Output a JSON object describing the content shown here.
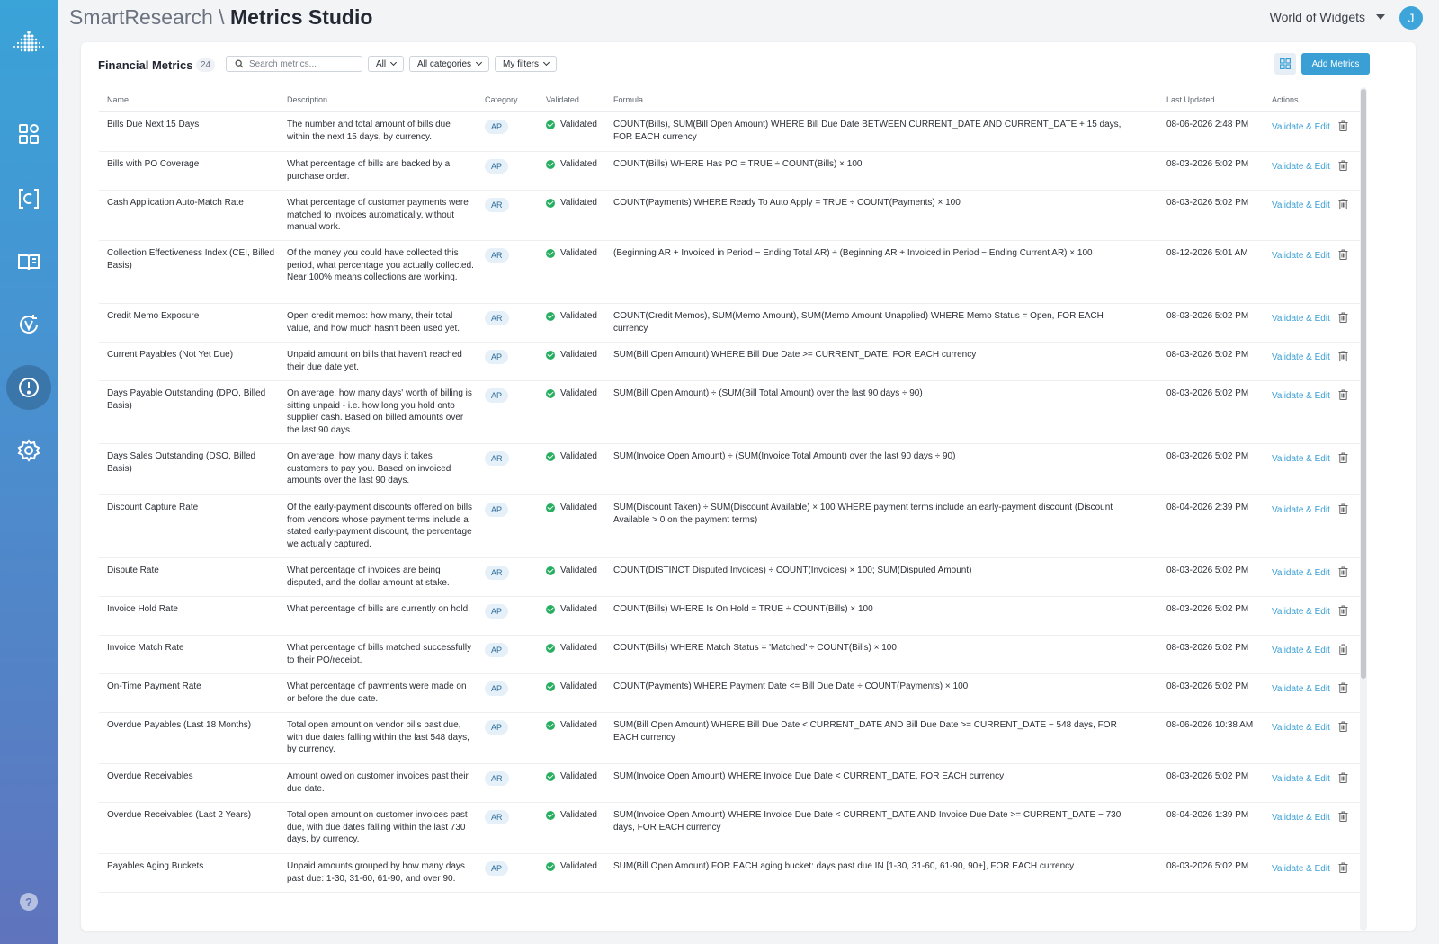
{
  "header": {
    "brand": "SmartResearch",
    "separator": " \\ ",
    "app_name": "Metrics Studio",
    "workspace": "World of Widgets",
    "avatar_initial": "J"
  },
  "toolbar": {
    "title": "Financial Metrics",
    "count": "24",
    "search_placeholder": "Search metrics...",
    "filter_status": "All",
    "filter_category": "All categories",
    "filter_mine": "My filters",
    "add_label": "Add Metrics"
  },
  "columns": {
    "name": "Name",
    "description": "Description",
    "category": "Category",
    "validated": "Validated",
    "formula": "Formula",
    "updated": "Last Updated",
    "actions": "Actions"
  },
  "action_label": "Validate & Edit",
  "help": "?",
  "colors": {
    "accent": "#3a9fd5",
    "validated": "#27ae60",
    "sidebar_top": "#3aa3d8",
    "sidebar_bottom": "#5f74bd"
  },
  "rows": [
    {
      "name": "Bills Due Next 15 Days",
      "description": "The number and total amount of bills due within the next 15 days, by currency.",
      "category": "AP",
      "validated": "Validated",
      "formula": "COUNT(Bills), SUM(Bill Open Amount) WHERE Bill Due Date BETWEEN CURRENT_DATE AND CURRENT_DATE + 15 days, FOR EACH currency",
      "updated": "08-06-2026 2:48 PM"
    },
    {
      "name": "Bills with PO Coverage",
      "description": "What percentage of bills are backed by a purchase order.",
      "category": "AP",
      "validated": "Validated",
      "formula": "COUNT(Bills) WHERE Has PO = TRUE ÷ COUNT(Bills) × 100",
      "updated": "08-03-2026 5:02 PM"
    },
    {
      "name": "Cash Application Auto-Match Rate",
      "description": "What percentage of customer payments were matched to invoices automatically, without manual work.",
      "category": "AR",
      "validated": "Validated",
      "formula": "COUNT(Payments) WHERE Ready To Auto Apply = TRUE ÷ COUNT(Payments) × 100",
      "updated": "08-03-2026 5:02 PM"
    },
    {
      "name": "Collection Effectiveness Index (CEI, Billed Basis)",
      "description": "Of the money you could have collected this period, what percentage you actually collected. Near 100% means collections are working.",
      "category": "AR",
      "validated": "Validated",
      "formula": "(Beginning AR + Invoiced in Period − Ending Total AR) ÷ (Beginning AR + Invoiced in Period − Ending Current AR) × 100",
      "updated": "08-12-2026 5:01 AM"
    },
    {
      "name": "Credit Memo Exposure",
      "description": "Open credit memos: how many, their total value, and how much hasn't been used yet.",
      "category": "AR",
      "validated": "Validated",
      "formula": "COUNT(Credit Memos), SUM(Memo Amount), SUM(Memo Amount Unapplied) WHERE Memo Status = Open, FOR EACH currency",
      "updated": "08-03-2026 5:02 PM"
    },
    {
      "name": "Current Payables (Not Yet Due)",
      "description": "Unpaid amount on bills that haven't reached their due date yet.",
      "category": "AP",
      "validated": "Validated",
      "formula": "SUM(Bill Open Amount) WHERE Bill Due Date >= CURRENT_DATE, FOR EACH currency",
      "updated": "08-03-2026 5:02 PM"
    },
    {
      "name": "Days Payable Outstanding (DPO, Billed Basis)",
      "description": "On average, how many days' worth of billing is sitting unpaid - i.e. how long you hold onto supplier cash. Based on billed amounts over the last 90 days.",
      "category": "AP",
      "validated": "Validated",
      "formula": "SUM(Bill Open Amount) ÷ (SUM(Bill Total Amount) over the last 90 days ÷ 90)",
      "updated": "08-03-2026 5:02 PM"
    },
    {
      "name": "Days Sales Outstanding (DSO, Billed Basis)",
      "description": "On average, how many days it takes customers to pay you. Based on invoiced amounts over the last 90 days.",
      "category": "AR",
      "validated": "Validated",
      "formula": "SUM(Invoice Open Amount) ÷ (SUM(Invoice Total Amount) over the last 90 days ÷ 90)",
      "updated": "08-03-2026 5:02 PM"
    },
    {
      "name": "Discount Capture Rate",
      "description": "Of the early-payment discounts offered on bills from vendors whose payment terms include a stated early-payment discount, the percentage we actually captured.",
      "category": "AP",
      "validated": "Validated",
      "formula": "SUM(Discount Taken) ÷ SUM(Discount Available) × 100 WHERE payment terms include an early-payment discount (Discount Available > 0 on the payment terms)",
      "updated": "08-04-2026 2:39 PM"
    },
    {
      "name": "Dispute Rate",
      "description": "What percentage of invoices are being disputed, and the dollar amount at stake.",
      "category": "AR",
      "validated": "Validated",
      "formula": "COUNT(DISTINCT Disputed Invoices) ÷ COUNT(Invoices) × 100; SUM(Disputed Amount)",
      "updated": "08-03-2026 5:02 PM"
    },
    {
      "name": "Invoice Hold Rate",
      "description": "What percentage of bills are currently on hold.",
      "category": "AP",
      "validated": "Validated",
      "formula": "COUNT(Bills) WHERE Is On Hold = TRUE ÷ COUNT(Bills) × 100",
      "updated": "08-03-2026 5:02 PM"
    },
    {
      "name": "Invoice Match Rate",
      "description": "What percentage of bills matched successfully to their PO/receipt.",
      "category": "AP",
      "validated": "Validated",
      "formula": "COUNT(Bills) WHERE Match Status = 'Matched' ÷ COUNT(Bills) × 100",
      "updated": "08-03-2026 5:02 PM"
    },
    {
      "name": "On-Time Payment Rate",
      "description": "What percentage of payments were made on or before the due date.",
      "category": "AP",
      "validated": "Validated",
      "formula": "COUNT(Payments) WHERE Payment Date <= Bill Due Date ÷ COUNT(Payments) × 100",
      "updated": "08-03-2026 5:02 PM"
    },
    {
      "name": "Overdue Payables (Last 18 Months)",
      "description": "Total open amount on vendor bills past due, with due dates falling within the last 548 days, by currency.",
      "category": "AP",
      "validated": "Validated",
      "formula": "SUM(Bill Open Amount) WHERE Bill Due Date < CURRENT_DATE AND Bill Due Date >= CURRENT_DATE − 548 days, FOR EACH currency",
      "updated": "08-06-2026 10:38 AM"
    },
    {
      "name": "Overdue Receivables",
      "description": "Amount owed on customer invoices past their due date.",
      "category": "AR",
      "validated": "Validated",
      "formula": "SUM(Invoice Open Amount) WHERE Invoice Due Date < CURRENT_DATE, FOR EACH currency",
      "updated": "08-03-2026 5:02 PM"
    },
    {
      "name": "Overdue Receivables (Last 2 Years)",
      "description": "Total open amount on customer invoices past due, with due dates falling within the last 730 days, by currency.",
      "category": "AR",
      "validated": "Validated",
      "formula": "SUM(Invoice Open Amount) WHERE Invoice Due Date < CURRENT_DATE AND Invoice Due Date >= CURRENT_DATE − 730 days, FOR EACH currency",
      "updated": "08-04-2026 1:39 PM"
    },
    {
      "name": "Payables Aging Buckets",
      "description": "Unpaid amounts grouped by how many days past due: 1-30, 31-60, 61-90, and over 90.",
      "category": "AP",
      "validated": "Validated",
      "formula": "SUM(Bill Open Amount) FOR EACH aging bucket: days past due IN [1-30, 31-60, 61-90, 90+], FOR EACH currency",
      "updated": "08-03-2026 5:02 PM"
    }
  ]
}
